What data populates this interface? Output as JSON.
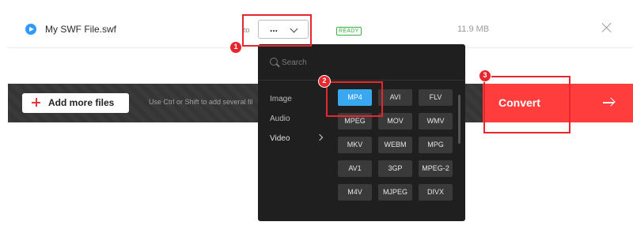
{
  "file": {
    "name": "My SWF File.swf",
    "to_label": "to",
    "format_value": "...",
    "status": "READY",
    "size": "11.9 MB"
  },
  "actions": {
    "add_label": "Add more files",
    "hint": "Use Ctrl or Shift to add several fil",
    "convert_label": "Convert"
  },
  "dropdown": {
    "search_placeholder": "Search",
    "categories": [
      "Image",
      "Audio",
      "Video"
    ],
    "active_category": "Video",
    "formats": [
      [
        "MP4",
        "AVI",
        "FLV"
      ],
      [
        "MPEG",
        "MOV",
        "WMV"
      ],
      [
        "MKV",
        "WEBM",
        "MPG"
      ],
      [
        "AV1",
        "3GP",
        "MPEG-2"
      ],
      [
        "M4V",
        "MJPEG",
        "DIVX"
      ]
    ],
    "selected_format": "MP4"
  },
  "annotations": [
    "1",
    "2",
    "3"
  ],
  "colors": {
    "accent_red": "#ff3d3d",
    "selected_blue": "#3aa8f0",
    "ready_green": "#3cb043",
    "annotation_red": "#e8262d"
  }
}
